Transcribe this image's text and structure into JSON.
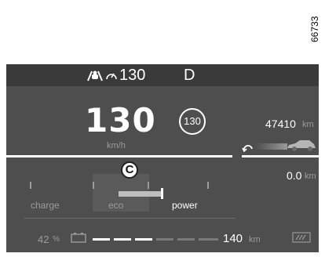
{
  "figure_id": "66733",
  "top_bar": {
    "limit_value": "130",
    "gear": "D"
  },
  "speed": {
    "value": "130",
    "unit": "km/h",
    "limit_value": "130"
  },
  "callout": "C",
  "power_gauge": {
    "labels": [
      "charge",
      "eco",
      "power"
    ],
    "active": "power"
  },
  "odometer": {
    "value": "47410",
    "unit": "km"
  },
  "trip": {
    "value": "0.0",
    "unit": "km"
  },
  "battery": {
    "percent": "42",
    "percent_unit": "%",
    "range_value": "140",
    "range_unit": "km",
    "level": 0.42
  },
  "icons": [
    "lane-assist-icon",
    "speedometer-limit-icon",
    "battery-icon",
    "reset-arrow-icon",
    "car-icon",
    "eco-drive-icon"
  ]
}
